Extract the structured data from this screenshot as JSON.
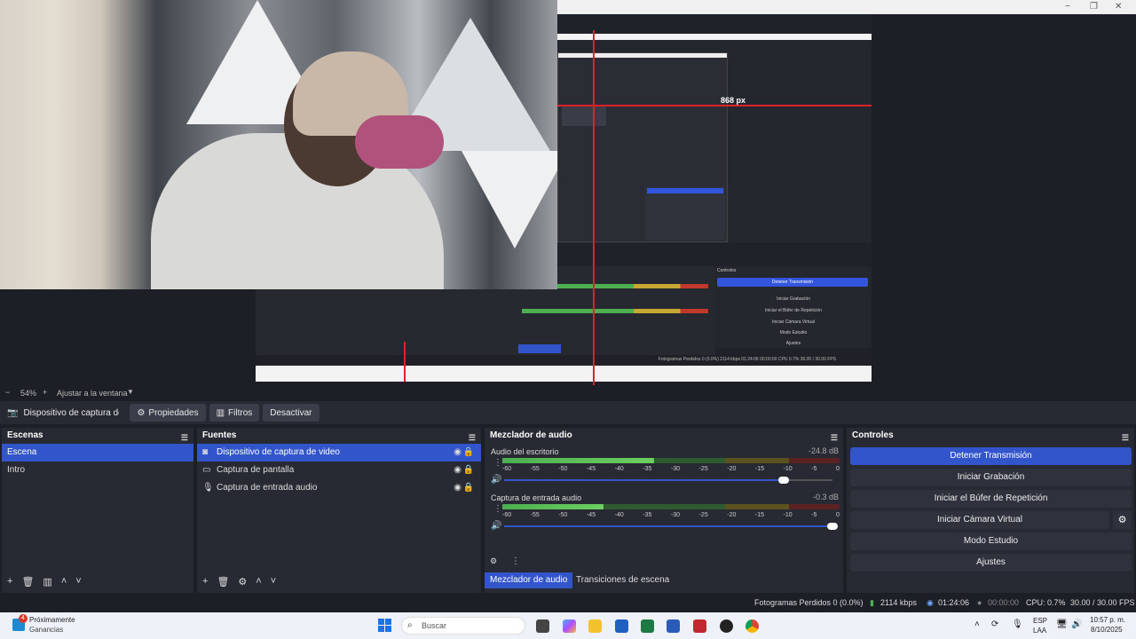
{
  "window": {
    "controls": [
      "−",
      "❐",
      "✕"
    ]
  },
  "preview": {
    "measure_label": "868 px",
    "nested_stop_label": "Detener Transmisión",
    "nested_controls_title": "Controles",
    "nested_controls_items": [
      "Iniciar Grabación",
      "Iniciar el Búfer de Repetición",
      "Iniciar Cámara Virtual",
      "Modo Estudio",
      "Ajustes"
    ],
    "nested_status": "Fotogramas Perdidos 0 (0.0%)   2114 kbps   01:24:06   00:00:00   CPU 0.7%   30.00 / 30.00 FPS"
  },
  "zoom": {
    "minus": "−",
    "value": "54%",
    "plus": "+",
    "fit_label": "Ajustar a la ventana"
  },
  "context_bar": {
    "source_name": "Dispositivo de captura de v",
    "properties_label": "Propiedades",
    "filters_label": "Filtros",
    "deactivate_label": "Desactivar"
  },
  "scenes": {
    "title": "Escenas",
    "items": [
      "Escena",
      "Intro"
    ]
  },
  "sources": {
    "title": "Fuentes",
    "items": [
      {
        "label": "Dispositivo de captura de video",
        "icon": "camera-icon"
      },
      {
        "label": "Captura de pantalla",
        "icon": "monitor-icon"
      },
      {
        "label": "Captura de entrada audio",
        "icon": "microphone-icon"
      }
    ]
  },
  "mixer": {
    "title": "Mezclador de audio",
    "ticks": [
      "-60",
      "-55",
      "-50",
      "-45",
      "-40",
      "-35",
      "-30",
      "-25",
      "-20",
      "-15",
      "-10",
      "-5",
      "0"
    ],
    "channels": [
      {
        "name": "Audio del escritorio",
        "db": "-24.8 dB",
        "level": 0.45,
        "volume": 0.85
      },
      {
        "name": "Captura de entrada audio",
        "db": "-0.3 dB",
        "level": 0.3,
        "volume": 1.0
      }
    ],
    "tab_mixer": "Mezclador de audio",
    "tab_transitions": "Transiciones de escena"
  },
  "controls": {
    "title": "Controles",
    "stop_stream": "Detener Transmisión",
    "start_recording": "Iniciar Grabación",
    "replay_buffer": "Iniciar el Búfer de Repetición",
    "virtual_camera": "Iniciar Cámara Virtual",
    "studio_mode": "Modo Estudio",
    "settings": "Ajustes"
  },
  "status": {
    "dropped_frames": "Fotogramas Perdidos 0 (0.0%)",
    "bitrate": "2114 kbps",
    "stream_time": "01:24:06",
    "record_time": "00:00:00",
    "cpu": "CPU: 0.7%",
    "fps": "30.00 / 30.00 FPS"
  },
  "taskbar": {
    "notification_badge": "4",
    "notification_title": "Próximamente",
    "notification_subtitle": "Ganancias",
    "search_placeholder": "Buscar",
    "lang_line1": "ESP",
    "lang_line2": "LAA",
    "time": "10:57 p. m.",
    "date": "8/10/2025"
  },
  "colors": {
    "accent": "#3355cc",
    "meter_green": "#4caf50",
    "meter_yellow": "#c8a832",
    "meter_red": "#c0392b"
  }
}
